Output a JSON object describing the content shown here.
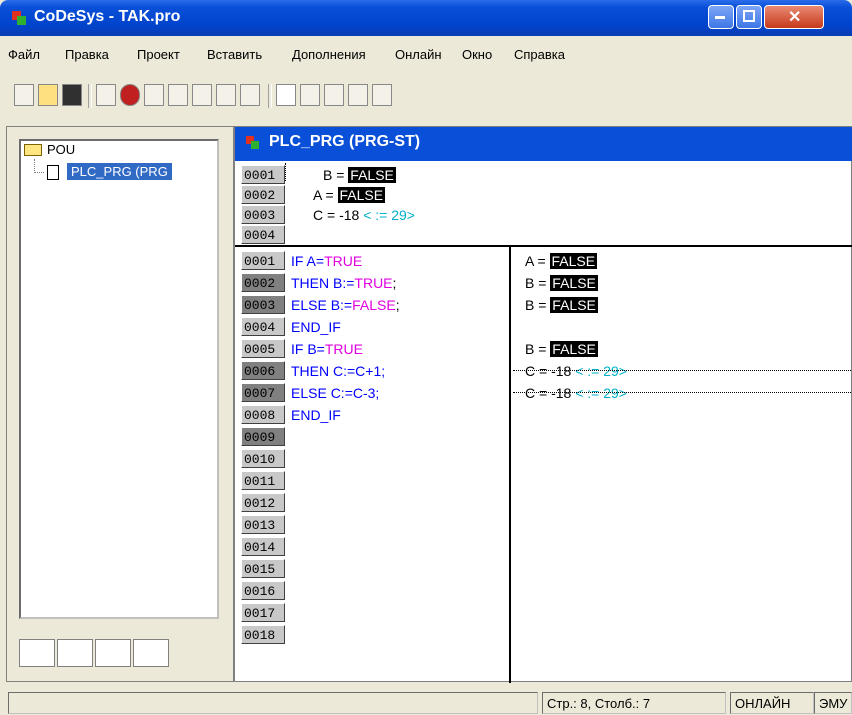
{
  "window": {
    "title": "CoDeSys - TAK.pro"
  },
  "menu": [
    "Файл",
    "Правка",
    "Проект",
    "Вставить",
    "Дополнения",
    "Онлайн",
    "Окно",
    "Справка"
  ],
  "tree": {
    "root": "POU",
    "item": "PLC_PRG (PRG"
  },
  "editor": {
    "title": "PLC_PRG (PRG-ST)",
    "decl": {
      "lines": [
        "0001",
        "0002",
        "0003",
        "0004"
      ],
      "values": [
        {
          "label": "B = ",
          "value": "FALSE"
        },
        {
          "label": "A = ",
          "value": "FALSE"
        },
        {
          "label": "C = -18",
          "extra": "< := 29>"
        }
      ]
    },
    "code": {
      "lines": [
        "0001",
        "0002",
        "0003",
        "0004",
        "0005",
        "0006",
        "0007",
        "0008",
        "0009",
        "0010",
        "0011",
        "0012",
        "0013",
        "0014",
        "0015",
        "0016",
        "0017",
        "0018"
      ],
      "statements": [
        {
          "a": "IF A=",
          "b": "TRUE",
          "c": ""
        },
        {
          "a": "THEN B:=",
          "b": "TRUE",
          "c": ";"
        },
        {
          "a": "ELSE B:=",
          "b": "FALSE",
          "c": ";"
        },
        {
          "a": "END_IF",
          "b": "",
          "c": ""
        },
        {
          "a": "IF B=",
          "b": "TRUE",
          "c": ""
        },
        {
          "a": "THEN C:=C+1;",
          "b": "",
          "c": ""
        },
        {
          "a": "ELSE C:=C-3;",
          "b": "",
          "c": ""
        },
        {
          "a": "END_IF",
          "b": "",
          "c": ""
        }
      ],
      "monitor": [
        {
          "label": "A = ",
          "value": "FALSE"
        },
        {
          "label": "B = ",
          "value": "FALSE"
        },
        {
          "label": "B = ",
          "value": "FALSE"
        },
        {
          "label": "B = ",
          "value": "FALSE"
        },
        {
          "label": "C = -18",
          "extra": "< := 29>"
        },
        {
          "label": "C = -18",
          "extra": "< := 29>"
        }
      ]
    }
  },
  "status": {
    "position": "Стр.: 8, Столб.: 7",
    "mode": "ОНЛАЙН",
    "emu": "ЭМУ"
  },
  "colors": {
    "title": "#0A4FD8",
    "keyword": "#0000FF",
    "literal": "#E000E0",
    "monitor_extra": "#00B0C8"
  }
}
